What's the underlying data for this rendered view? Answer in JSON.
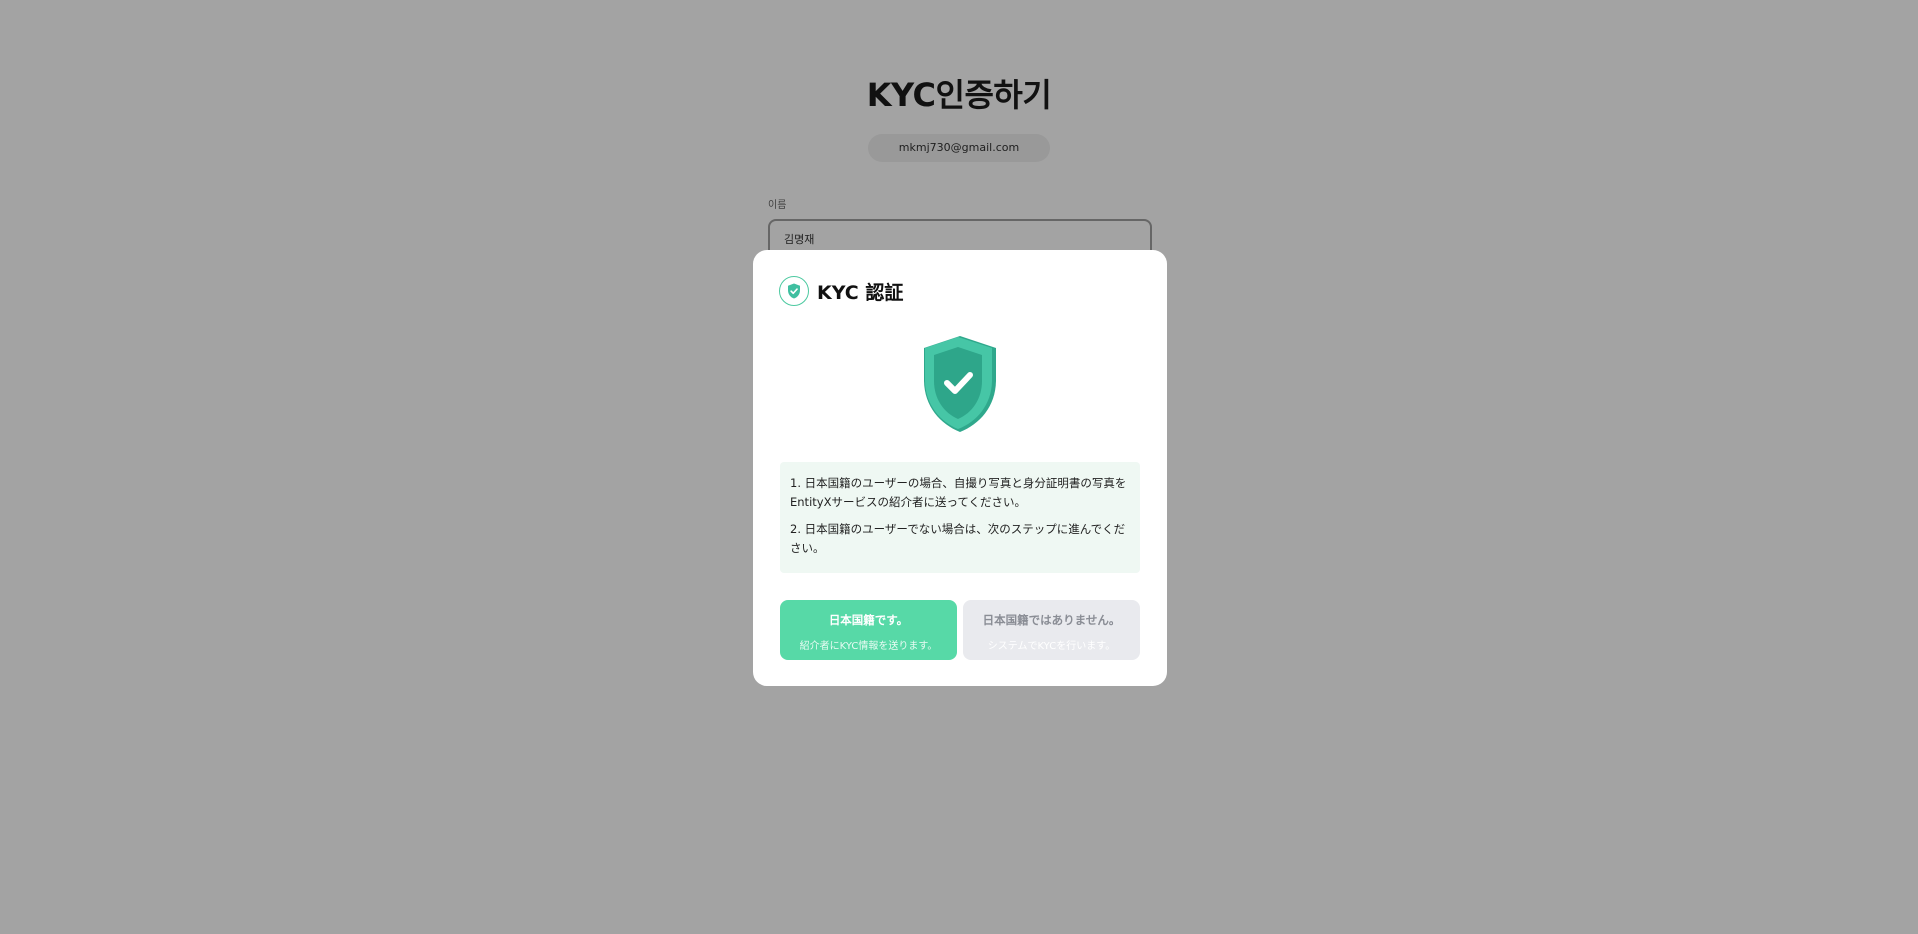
{
  "page": {
    "title": "KYC인증하기",
    "email": "mkmj730@gmail.com",
    "name_label": "이름",
    "name_value": "김명재"
  },
  "modal": {
    "title": "KYC 認証",
    "header_icon": "shield-check-icon",
    "illustration_icon": "shield-check-illustration",
    "info": [
      "1. 日本国籍のユーザーの場合、自撮り写真と身分証明書の写真をEntityXサービスの紹介者に送ってください。",
      "2. 日本国籍のユーザーでない場合は、次のステップに進んでください。"
    ],
    "buttons": {
      "japanese": {
        "label": "日本国籍です。",
        "sub": "紹介者にKYC情報を送ります。"
      },
      "not_japanese": {
        "label": "日本国籍ではありません。",
        "sub": "システムでKYCを行います。"
      }
    }
  },
  "colors": {
    "accent": "#57d9a7",
    "shield": "#3fbfa0",
    "info_bg": "#eff8f3",
    "secondary_button": "#e9eaee"
  }
}
